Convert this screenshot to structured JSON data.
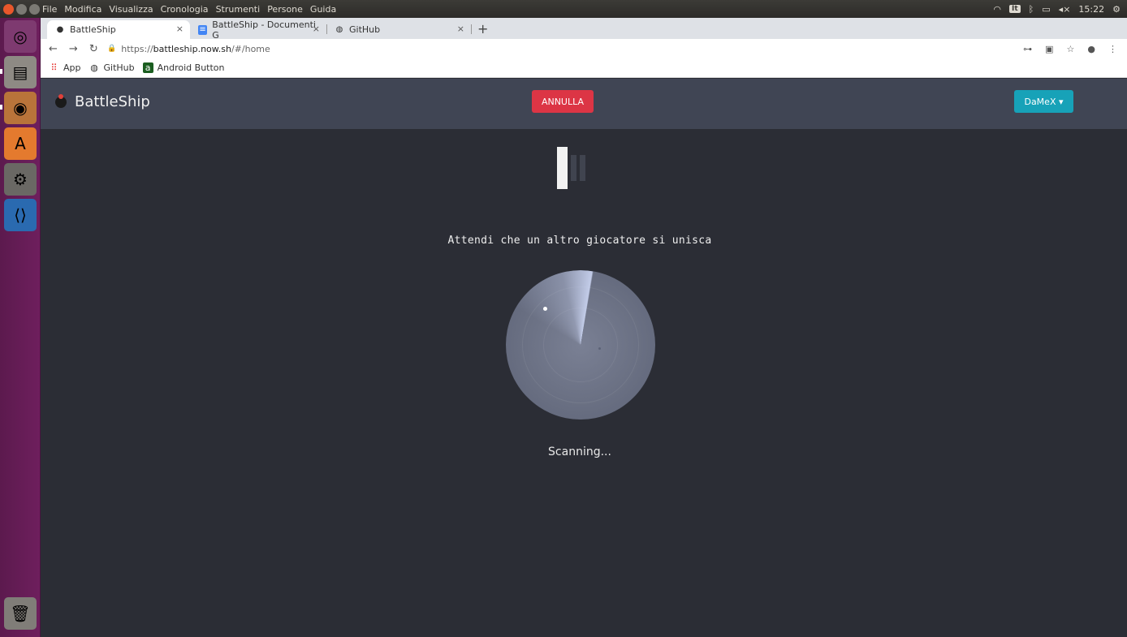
{
  "os_panel": {
    "menus": [
      "File",
      "Modifica",
      "Visualizza",
      "Cronologia",
      "Strumenti",
      "Persone",
      "Guida"
    ],
    "keyboard_layout": "It",
    "clock": "15:22"
  },
  "browser": {
    "tabs": [
      {
        "title": "BattleShip",
        "active": true
      },
      {
        "title": "BattleShip - Documenti G",
        "active": false
      },
      {
        "title": "GitHub",
        "active": false
      }
    ],
    "url_scheme": "https://",
    "url_host": "battleship.now.sh",
    "url_path": "/#/home",
    "bookmarks": [
      "App",
      "GitHub",
      "Android Button"
    ]
  },
  "app": {
    "brand": "BattleShip",
    "cancel_button": "ANNULLA",
    "user_menu": "DaMeX",
    "wait_message": "Attendi che un altro giocatore si unisca",
    "status": "Scanning..."
  },
  "colors": {
    "navbar": "#404554",
    "page_bg": "#2b2d35",
    "cancel": "#dc3545",
    "user": "#17a2b8",
    "launcher": "#6e1f5d"
  },
  "icons": [
    "ubuntu-icon",
    "files-icon",
    "chrome-icon",
    "software-store-icon",
    "settings-icon",
    "vscode-icon",
    "trash-icon"
  ]
}
